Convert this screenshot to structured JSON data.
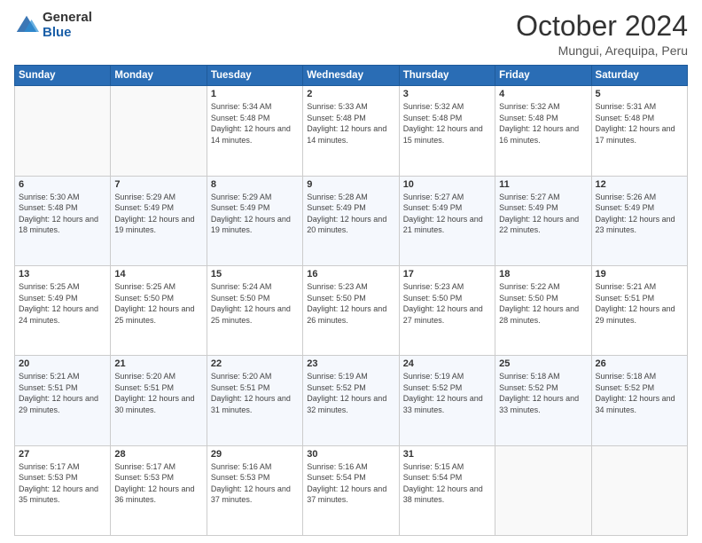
{
  "header": {
    "logo_general": "General",
    "logo_blue": "Blue",
    "month_title": "October 2024",
    "location": "Mungui, Arequipa, Peru"
  },
  "days_of_week": [
    "Sunday",
    "Monday",
    "Tuesday",
    "Wednesday",
    "Thursday",
    "Friday",
    "Saturday"
  ],
  "weeks": [
    [
      {
        "day": "",
        "info": ""
      },
      {
        "day": "",
        "info": ""
      },
      {
        "day": "1",
        "info": "Sunrise: 5:34 AM\nSunset: 5:48 PM\nDaylight: 12 hours and 14 minutes."
      },
      {
        "day": "2",
        "info": "Sunrise: 5:33 AM\nSunset: 5:48 PM\nDaylight: 12 hours and 14 minutes."
      },
      {
        "day": "3",
        "info": "Sunrise: 5:32 AM\nSunset: 5:48 PM\nDaylight: 12 hours and 15 minutes."
      },
      {
        "day": "4",
        "info": "Sunrise: 5:32 AM\nSunset: 5:48 PM\nDaylight: 12 hours and 16 minutes."
      },
      {
        "day": "5",
        "info": "Sunrise: 5:31 AM\nSunset: 5:48 PM\nDaylight: 12 hours and 17 minutes."
      }
    ],
    [
      {
        "day": "6",
        "info": "Sunrise: 5:30 AM\nSunset: 5:48 PM\nDaylight: 12 hours and 18 minutes."
      },
      {
        "day": "7",
        "info": "Sunrise: 5:29 AM\nSunset: 5:49 PM\nDaylight: 12 hours and 19 minutes."
      },
      {
        "day": "8",
        "info": "Sunrise: 5:29 AM\nSunset: 5:49 PM\nDaylight: 12 hours and 19 minutes."
      },
      {
        "day": "9",
        "info": "Sunrise: 5:28 AM\nSunset: 5:49 PM\nDaylight: 12 hours and 20 minutes."
      },
      {
        "day": "10",
        "info": "Sunrise: 5:27 AM\nSunset: 5:49 PM\nDaylight: 12 hours and 21 minutes."
      },
      {
        "day": "11",
        "info": "Sunrise: 5:27 AM\nSunset: 5:49 PM\nDaylight: 12 hours and 22 minutes."
      },
      {
        "day": "12",
        "info": "Sunrise: 5:26 AM\nSunset: 5:49 PM\nDaylight: 12 hours and 23 minutes."
      }
    ],
    [
      {
        "day": "13",
        "info": "Sunrise: 5:25 AM\nSunset: 5:49 PM\nDaylight: 12 hours and 24 minutes."
      },
      {
        "day": "14",
        "info": "Sunrise: 5:25 AM\nSunset: 5:50 PM\nDaylight: 12 hours and 25 minutes."
      },
      {
        "day": "15",
        "info": "Sunrise: 5:24 AM\nSunset: 5:50 PM\nDaylight: 12 hours and 25 minutes."
      },
      {
        "day": "16",
        "info": "Sunrise: 5:23 AM\nSunset: 5:50 PM\nDaylight: 12 hours and 26 minutes."
      },
      {
        "day": "17",
        "info": "Sunrise: 5:23 AM\nSunset: 5:50 PM\nDaylight: 12 hours and 27 minutes."
      },
      {
        "day": "18",
        "info": "Sunrise: 5:22 AM\nSunset: 5:50 PM\nDaylight: 12 hours and 28 minutes."
      },
      {
        "day": "19",
        "info": "Sunrise: 5:21 AM\nSunset: 5:51 PM\nDaylight: 12 hours and 29 minutes."
      }
    ],
    [
      {
        "day": "20",
        "info": "Sunrise: 5:21 AM\nSunset: 5:51 PM\nDaylight: 12 hours and 29 minutes."
      },
      {
        "day": "21",
        "info": "Sunrise: 5:20 AM\nSunset: 5:51 PM\nDaylight: 12 hours and 30 minutes."
      },
      {
        "day": "22",
        "info": "Sunrise: 5:20 AM\nSunset: 5:51 PM\nDaylight: 12 hours and 31 minutes."
      },
      {
        "day": "23",
        "info": "Sunrise: 5:19 AM\nSunset: 5:52 PM\nDaylight: 12 hours and 32 minutes."
      },
      {
        "day": "24",
        "info": "Sunrise: 5:19 AM\nSunset: 5:52 PM\nDaylight: 12 hours and 33 minutes."
      },
      {
        "day": "25",
        "info": "Sunrise: 5:18 AM\nSunset: 5:52 PM\nDaylight: 12 hours and 33 minutes."
      },
      {
        "day": "26",
        "info": "Sunrise: 5:18 AM\nSunset: 5:52 PM\nDaylight: 12 hours and 34 minutes."
      }
    ],
    [
      {
        "day": "27",
        "info": "Sunrise: 5:17 AM\nSunset: 5:53 PM\nDaylight: 12 hours and 35 minutes."
      },
      {
        "day": "28",
        "info": "Sunrise: 5:17 AM\nSunset: 5:53 PM\nDaylight: 12 hours and 36 minutes."
      },
      {
        "day": "29",
        "info": "Sunrise: 5:16 AM\nSunset: 5:53 PM\nDaylight: 12 hours and 37 minutes."
      },
      {
        "day": "30",
        "info": "Sunrise: 5:16 AM\nSunset: 5:54 PM\nDaylight: 12 hours and 37 minutes."
      },
      {
        "day": "31",
        "info": "Sunrise: 5:15 AM\nSunset: 5:54 PM\nDaylight: 12 hours and 38 minutes."
      },
      {
        "day": "",
        "info": ""
      },
      {
        "day": "",
        "info": ""
      }
    ]
  ]
}
